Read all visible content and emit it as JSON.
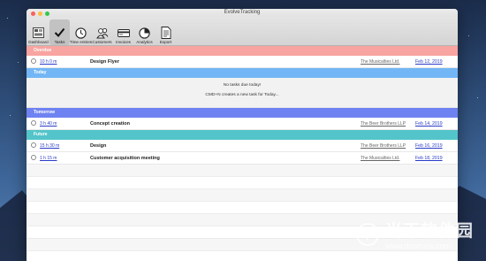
{
  "window": {
    "title": "EvolveTracking"
  },
  "toolbar": {
    "items": [
      {
        "label": "Dashboard",
        "icon": "dashboard-icon"
      },
      {
        "label": "Tasks",
        "icon": "checkmark-icon",
        "active": true
      },
      {
        "label": "Time entries",
        "icon": "clock-icon"
      },
      {
        "label": "Customers",
        "icon": "people-icon"
      },
      {
        "label": "Invoices",
        "icon": "invoice-icon"
      },
      {
        "label": "Analytics",
        "icon": "chart-icon"
      },
      {
        "label": "Export",
        "icon": "export-icon"
      }
    ]
  },
  "sections": {
    "overdue": {
      "label": "Overdue",
      "color": "#f8a4a0"
    },
    "today": {
      "label": "Today",
      "color": "#72b6f5"
    },
    "tomorrow": {
      "label": "Tomorrow",
      "color": "#6f82f2"
    },
    "future": {
      "label": "Future",
      "color": "#53c4c9"
    }
  },
  "tasks": {
    "overdue": [
      {
        "time": "10 h 0 m",
        "title": "Design Flyer",
        "client": "The Musicalties Ltd.",
        "due": "Feb 12, 2019"
      }
    ],
    "today_empty": {
      "line1": "No tasks due today!",
      "line2": "CMD+N creates a new task for Today..."
    },
    "tomorrow": [
      {
        "time": "3 h 40 m",
        "title": "Concept creation",
        "client": "The Beer Brothers LLP",
        "due": "Feb 14, 2019"
      }
    ],
    "future": [
      {
        "time": "15 h 30 m",
        "title": "Design",
        "client": "The Beer Brothers LLP",
        "due": "Feb 16, 2019"
      },
      {
        "time": "1 h 15 m",
        "title": "Customer acquisition meeting",
        "client": "The Musicalties Ltd.",
        "due": "Feb 18, 2019"
      }
    ]
  },
  "watermark": {
    "logo_text": "当下软件园",
    "url": "www.downxia.com"
  }
}
